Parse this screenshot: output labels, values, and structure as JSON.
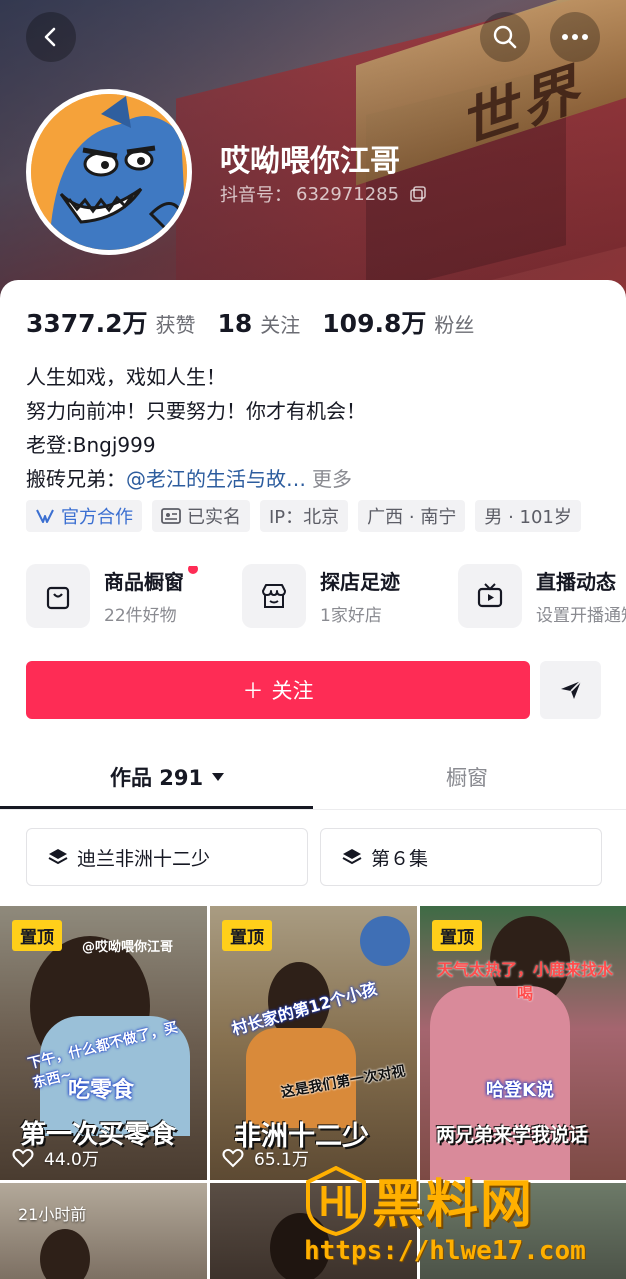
{
  "profile": {
    "nickname": "哎呦喂你江哥",
    "douyin_id_label": "抖音号：",
    "douyin_id": "632971285",
    "header_sign_text": "世界"
  },
  "stats": [
    {
      "value": "3377.2万",
      "label": "获赞"
    },
    {
      "value": "18",
      "label": "关注"
    },
    {
      "value": "109.8万",
      "label": "粉丝"
    }
  ],
  "bio": {
    "line1": "人生如戏，戏如人生！",
    "line2": "努力向前冲！只要努力！你才有机会！",
    "line3": "老登:Bngj999",
    "line4_prefix": "搬砖兄弟：",
    "line4_link": "@老江的生活与故…",
    "more": "更多"
  },
  "tags": [
    {
      "label": "官方合作",
      "icon": "official-cooperation-icon"
    },
    {
      "label": "已实名",
      "icon": "id-card-icon"
    },
    {
      "label": "IP：北京"
    },
    {
      "label": "广西 · 南宁"
    },
    {
      "label": "男 · 101岁"
    }
  ],
  "services": [
    {
      "title": "商品橱窗",
      "subtitle": "22件好物",
      "icon": "shopping-bag-icon",
      "has_dot": true
    },
    {
      "title": "探店足迹",
      "subtitle": "1家好店",
      "icon": "store-icon"
    },
    {
      "title": "直播动态",
      "subtitle": "设置开播通知",
      "icon": "tv-icon"
    }
  ],
  "actions": {
    "follow_label": "关注",
    "follow_prefix": "＋"
  },
  "tabs": {
    "works_label": "作品 291",
    "shop_label": "橱窗"
  },
  "collections": [
    {
      "label": "迪兰非洲十二少",
      "icon": "layers-icon"
    },
    {
      "label": "第６集",
      "icon": "layers-icon"
    }
  ],
  "videos": [
    {
      "pinned_label": "置顶",
      "watermark": "@哎呦喂你江哥",
      "caption_top": "吃零食",
      "caption": "第一次买零食",
      "likes": "44.0万",
      "note": "下午，什么都不做了，买东西~"
    },
    {
      "pinned_label": "置顶",
      "caption_top": "村长家的第12个小孩",
      "caption_mid": "这是我们第一次对视",
      "caption": "非洲十二少",
      "likes": "65.1万"
    },
    {
      "pinned_label": "置顶",
      "caption_red": "天气太热了，小鹿来找水喝",
      "caption_top": "哈登K说",
      "caption": "两兄弟来学我说话"
    },
    {
      "time": "21小时前"
    },
    {},
    {}
  ],
  "site_watermark": {
    "title": "黑料网",
    "url": "https://hlwe17.com"
  },
  "colors": {
    "accent": "#fe2c55",
    "pin_badge": "#ffcf1a",
    "link": "#2c5c9e",
    "watermark_gold": "#ffb000"
  }
}
